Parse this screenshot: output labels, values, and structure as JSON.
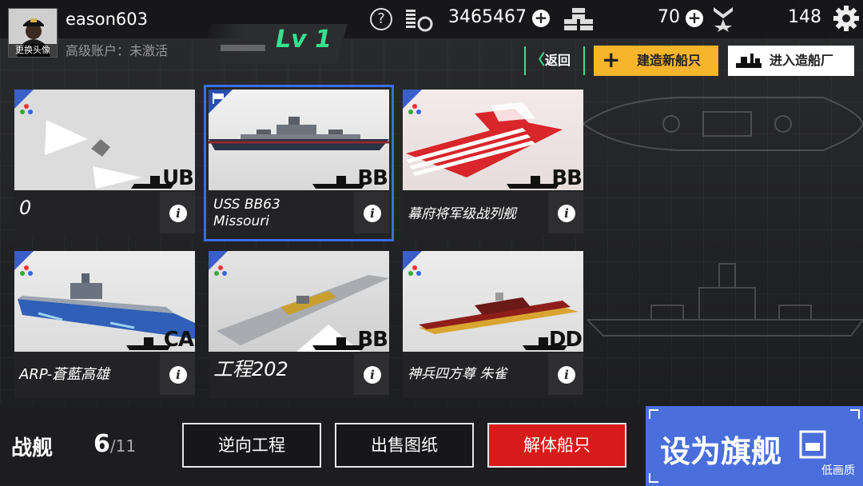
{
  "user": {
    "name": "eason603",
    "avatar_label": "更换头像",
    "account_status": "高级账户：未激活",
    "level": "Lv 1"
  },
  "resources": {
    "coins": "3465467",
    "supplies": "70",
    "rank_points": "148"
  },
  "actions": {
    "back": "返回",
    "build_ship": "建造新船只",
    "enter_dock": "进入造船厂"
  },
  "ships": [
    {
      "name": "0",
      "class": "UB",
      "selected": false
    },
    {
      "name": "USS BB63\nMissouri",
      "name_line1": "USS BB63",
      "name_line2": "Missouri",
      "class": "BB",
      "selected": true
    },
    {
      "name": "幕府将军级战列舰",
      "class": "BB",
      "selected": false
    },
    {
      "name": "ARP-蒼藍高雄",
      "class": "CA",
      "selected": false
    },
    {
      "name": "工程202",
      "class": "BB",
      "selected": false
    },
    {
      "name": "神兵四方尊 朱雀",
      "class": "DD",
      "selected": false
    }
  ],
  "info_glyph": "i",
  "bottom": {
    "type_label": "战舰",
    "count": "6",
    "count_total": "/11",
    "reverse_engineer": "逆向工程",
    "sell_blueprint": "出售图纸",
    "dismantle": "解体船只",
    "set_flagship": "设为旗舰",
    "quality": "低画质"
  },
  "colors": {
    "accent_green": "#37e08e",
    "build_yellow": "#f6b52b",
    "dismantle_red": "#d71b1b",
    "flagship_blue": "#4a6fdc",
    "selected_outline": "#3a6ee8"
  },
  "icons": [
    "help-icon",
    "coins-icon",
    "crates-icon",
    "rank-icon",
    "gear-icon",
    "flag-icon",
    "palette-icon",
    "info-icon"
  ]
}
